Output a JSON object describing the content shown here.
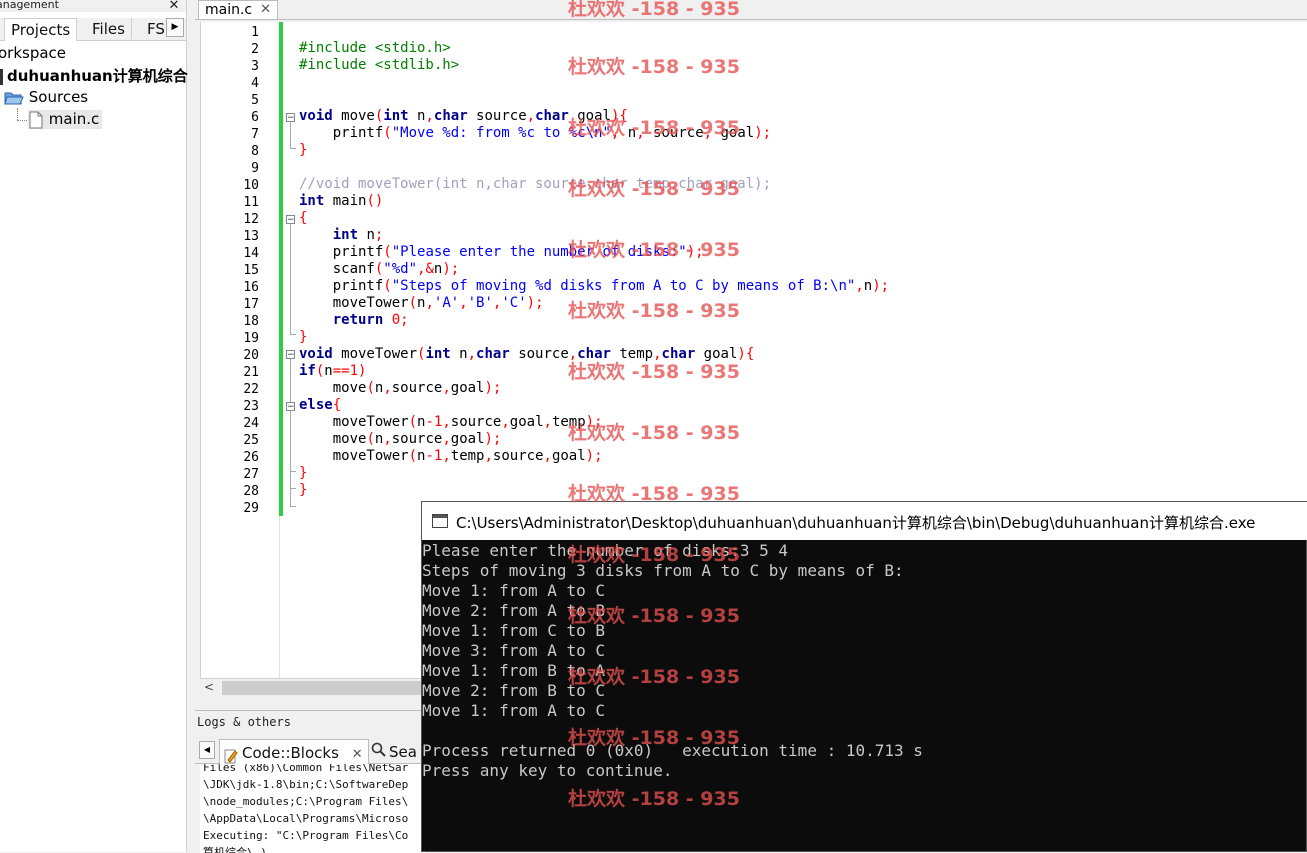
{
  "management": {
    "title": "anagement",
    "tabs": [
      "Projects",
      "Files",
      "FS"
    ],
    "tree": {
      "workspace": "orkspace",
      "project": "duhuanhuan计算机综合",
      "sources": "Sources",
      "file": "main.c"
    }
  },
  "editor": {
    "tab_label": "main.c",
    "line_numbers": [
      "1",
      "2",
      "3",
      "4",
      "5",
      "6",
      "7",
      "8",
      "9",
      "10",
      "11",
      "12",
      "13",
      "14",
      "15",
      "16",
      "17",
      "18",
      "19",
      "20",
      "21",
      "22",
      "23",
      "24",
      "25",
      "26",
      "27",
      "28",
      "29"
    ]
  },
  "logs": {
    "title": "Logs & others",
    "tabs": [
      "Code::Blocks",
      "Sea"
    ],
    "lines": [
      "Files (x86)\\Common Files\\NetSar",
      "\\JDK\\jdk-1.8\\bin;C:\\SoftwareDep",
      "\\node_modules;C:\\Program Files\\",
      "\\AppData\\Local\\Programs\\Microso",
      "Executing: \"C:\\Program Files\\Co",
      "算机综合\\.)"
    ]
  },
  "console": {
    "title": "C:\\Users\\Administrator\\Desktop\\duhuanhuan\\duhuanhuan计算机综合\\bin\\Debug\\duhuanhuan计算机综合.exe",
    "lines": [
      "Please enter the number of disks:3 5 4",
      "Steps of moving 3 disks from A to C by means of B:",
      "Move 1: from A to C",
      "Move 2: from A to B",
      "Move 1: from C to B",
      "Move 3: from A to C",
      "Move 1: from B to A",
      "Move 2: from B to C",
      "Move 1: from A to C",
      "",
      "Process returned 0 (0x0)   execution time : 10.713 s",
      "Press any key to continue."
    ]
  },
  "watermark": "杜欢欢 -158 - 935",
  "colors": {
    "keyword": "#00008b",
    "string": "#0000ff",
    "preprocessor": "#008000",
    "number": "#ff0000",
    "comment": "#a0a0c0",
    "changebar": "#2ecc40",
    "watermark": "#e45050"
  }
}
